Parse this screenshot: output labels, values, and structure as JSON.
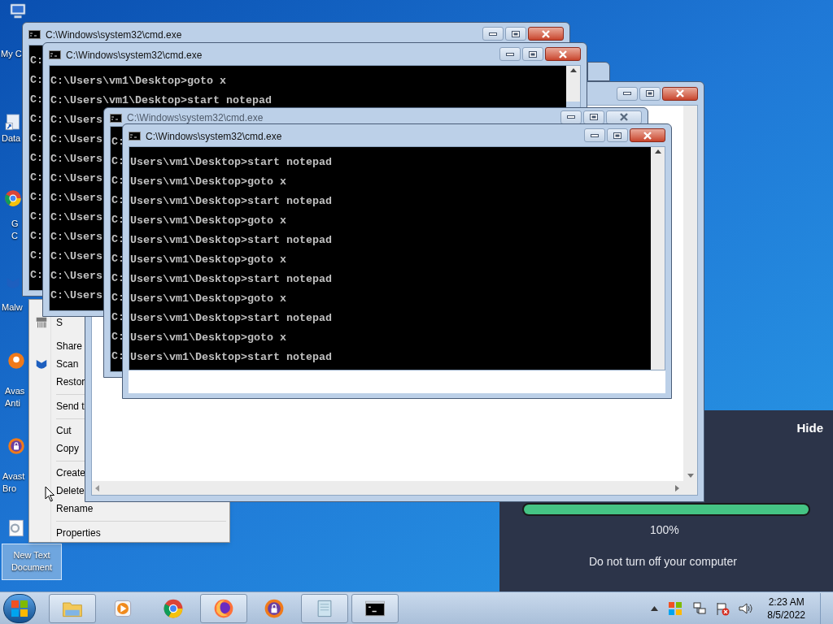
{
  "desktop_icons": [
    {
      "label": "My C",
      "kind": "computer",
      "selected": false
    },
    {
      "label": "Data",
      "kind": "shortcut",
      "selected": false
    },
    {
      "label": "G\nC",
      "kind": "chrome",
      "selected": false
    },
    {
      "label": "Malw",
      "kind": "malware",
      "selected": false
    },
    {
      "label": "Avas\nAnti",
      "kind": "avast",
      "selected": false
    },
    {
      "label": "Avast\nBro",
      "kind": "avastbrowser",
      "selected": false
    },
    {
      "label": "New Text\nDocument",
      "kind": "file",
      "selected": true
    }
  ],
  "context_menu": {
    "items": [
      {
        "label": "S",
        "kind": "shred"
      },
      {
        "label": "Share",
        "kind": "plain"
      },
      {
        "label": "Scan",
        "kind": "malware"
      },
      {
        "label": "Restor",
        "kind": "plain"
      },
      {
        "kind": "separator"
      },
      {
        "label": "Send t",
        "kind": "plain"
      },
      {
        "kind": "separator"
      },
      {
        "label": "Cut",
        "kind": "plain"
      },
      {
        "label": "Copy",
        "kind": "plain"
      },
      {
        "kind": "separator"
      },
      {
        "label": "Create",
        "kind": "plain"
      },
      {
        "label": "Delete",
        "kind": "plain"
      },
      {
        "label": "Rename",
        "kind": "plain"
      },
      {
        "kind": "separator"
      },
      {
        "label": "Properties",
        "kind": "plain"
      }
    ]
  },
  "windows": [
    {
      "title": "C:\\Windows\\system32\\cmd.exe",
      "active": true,
      "lines": [
        "C:",
        "C:",
        "C:",
        "C:",
        "C:",
        "C:",
        "C:",
        "C:",
        "C:",
        "C:",
        "C:",
        "C:"
      ]
    },
    {
      "title": "C:\\Windows\\system32\\cmd.exe",
      "active": true,
      "lines": [
        "C:\\Users\\vm1\\Desktop>goto x",
        "C:\\Users\\vm1\\Desktop>start notepad",
        "C:\\Users",
        "C:\\Users",
        "C:\\Users",
        "C:\\Users",
        "C:\\Users",
        "C:\\Users",
        "C:\\Users",
        "C:\\Users",
        "C:\\Users",
        "C:\\Users"
      ]
    },
    {
      "title": "C:\\Windows\\system32\\cmd.exe",
      "active": false,
      "lines": [
        "C:",
        "C:",
        "C:",
        "C:",
        "C:",
        "C:",
        "C:",
        "C:",
        "C:",
        "C:",
        "C:",
        "C:"
      ]
    },
    {
      "title": "C:\\Windows\\system32\\cmd.exe",
      "active": true,
      "lines": [
        "Users\\vm1\\Desktop>start notepad",
        "Users\\vm1\\Desktop>goto x",
        "Users\\vm1\\Desktop>start notepad",
        "Users\\vm1\\Desktop>goto x",
        "Users\\vm1\\Desktop>start notepad",
        "Users\\vm1\\Desktop>goto x",
        "Users\\vm1\\Desktop>start notepad",
        "Users\\vm1\\Desktop>goto x",
        "Users\\vm1\\Desktop>start notepad",
        "Users\\vm1\\Desktop>goto x",
        "Users\\vm1\\Desktop>start notepad"
      ]
    }
  ],
  "update_panel": {
    "hide": "Hide",
    "level": 1,
    "percent": "100%",
    "message": "Do not turn off your computer"
  },
  "taskbar": {
    "items": [
      {
        "kind": "explorer",
        "open": true
      },
      {
        "kind": "media",
        "open": false
      },
      {
        "kind": "chrome",
        "open": false
      },
      {
        "kind": "firefox",
        "open": true
      },
      {
        "kind": "avastbrowser",
        "open": false
      },
      {
        "kind": "notepad",
        "open": true
      },
      {
        "kind": "cmd",
        "open": true
      }
    ],
    "clock": {
      "time": "2:23 AM",
      "date": "8/5/2022"
    }
  }
}
